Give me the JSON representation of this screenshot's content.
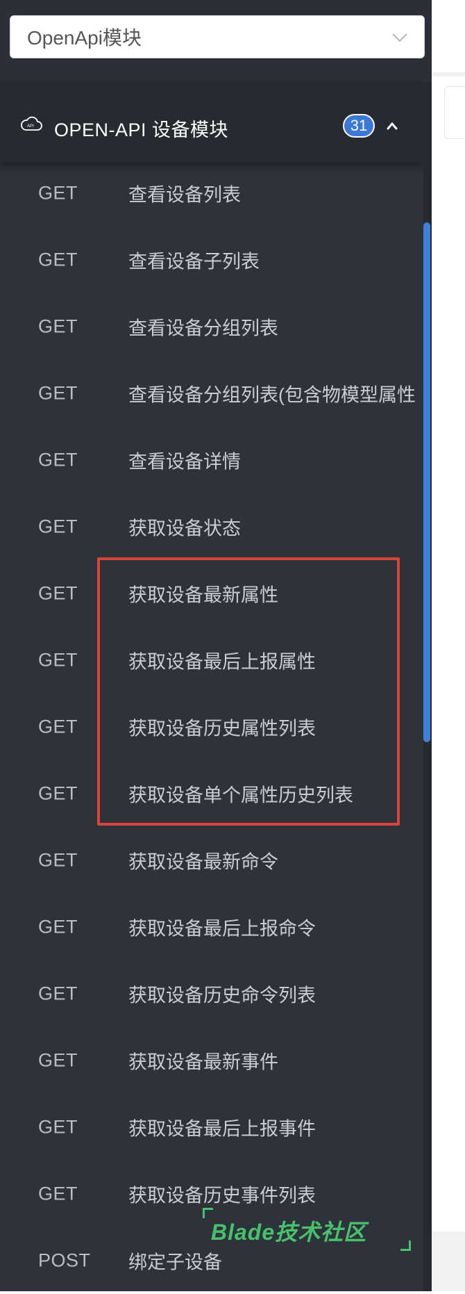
{
  "module_select": {
    "value": "OpenApi模块"
  },
  "group": {
    "title": "OPEN-API 设备模块",
    "count": "31",
    "icon": "cloud-api-icon"
  },
  "items": [
    {
      "method": "GET",
      "label": "查看设备列表"
    },
    {
      "method": "GET",
      "label": "查看设备子列表"
    },
    {
      "method": "GET",
      "label": "查看设备分组列表"
    },
    {
      "method": "GET",
      "label": "查看设备分组列表(包含物模型属性"
    },
    {
      "method": "GET",
      "label": "查看设备详情"
    },
    {
      "method": "GET",
      "label": "获取设备状态"
    },
    {
      "method": "GET",
      "label": "获取设备最新属性"
    },
    {
      "method": "GET",
      "label": "获取设备最后上报属性"
    },
    {
      "method": "GET",
      "label": "获取设备历史属性列表"
    },
    {
      "method": "GET",
      "label": "获取设备单个属性历史列表"
    },
    {
      "method": "GET",
      "label": "获取设备最新命令"
    },
    {
      "method": "GET",
      "label": "获取设备最后上报命令"
    },
    {
      "method": "GET",
      "label": "获取设备历史命令列表"
    },
    {
      "method": "GET",
      "label": "获取设备最新事件"
    },
    {
      "method": "GET",
      "label": "获取设备最后上报事件"
    },
    {
      "method": "GET",
      "label": "获取设备历史事件列表"
    },
    {
      "method": "POST",
      "label": "绑定子设备"
    }
  ],
  "watermark": {
    "text": "Blade技术社区"
  },
  "colors": {
    "sidebar_bg": "#2e333b",
    "header_bg": "#262a31",
    "accent_blue": "#3b78d8",
    "highlight_red": "#d9453a",
    "watermark_green": "#47c26b"
  }
}
